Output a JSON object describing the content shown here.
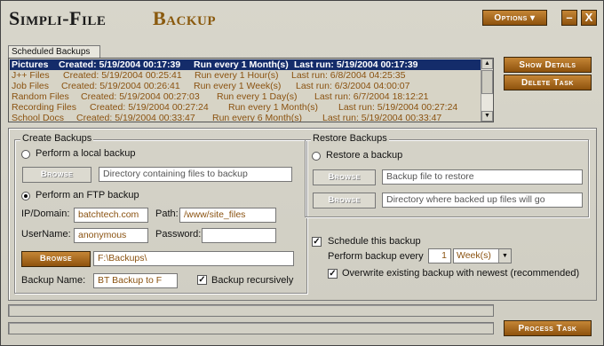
{
  "title": {
    "part1": "Simpli-File",
    "part2": "Backup"
  },
  "window_buttons": {
    "options": "Options ▾",
    "minimize": "–",
    "close": "X"
  },
  "scheduled": {
    "tab_label": "Scheduled Backups",
    "rows": [
      {
        "name": "Pictures",
        "created": "Created: 5/19/2004 00:17:39",
        "every": "Run every 1 Month(s)",
        "last": "Last run: 5/19/2004 00:17:39",
        "selected": true
      },
      {
        "name": "J++ Files",
        "created": "Created: 5/19/2004 00:25:41",
        "every": "Run every 1 Hour(s)",
        "last": "Last run: 6/8/2004 04:25:35"
      },
      {
        "name": "Job Files",
        "created": "Created: 5/19/2004 00:26:41",
        "every": "Run every 1 Week(s)",
        "last": "Last run: 6/3/2004 04:00:07"
      },
      {
        "name": "Random Files",
        "created": "Created: 5/19/2004 00:27:03",
        "every": "Run every 1 Day(s)",
        "last": "Last run: 6/7/2004 18:12:21"
      },
      {
        "name": "Recording Files",
        "created": "Created: 5/19/2004 00:27:24",
        "every": "Run every 1 Month(s)",
        "last": "Last run: 5/19/2004 00:27:24"
      },
      {
        "name": "School Docs",
        "created": "Created: 5/19/2004 00:33:47",
        "every": "Run every 6 Month(s)",
        "last": "Last run: 5/19/2004 00:33:47"
      }
    ],
    "show_details": "Show Details",
    "delete_task": "Delete Task"
  },
  "create": {
    "group_label": "Create Backups",
    "local_radio": "Perform a local backup",
    "browse": "Browse",
    "local_placeholder": "Directory containing files to backup",
    "ftp_radio": "Perform an FTP backup",
    "ip_label": "IP/Domain:",
    "ip_value": "batchtech.com",
    "path_label": "Path:",
    "path_value": "/www/site_files",
    "user_label": "UserName:",
    "user_value": "anonymous",
    "pass_label": "Password:",
    "pass_value": "",
    "dest_browse": "Browse",
    "dest_value": "F:\\Backups\\",
    "name_label": "Backup Name:",
    "name_value": "BT Backup to F",
    "recursive_label": "Backup recursively"
  },
  "restore": {
    "group_label": "Restore Backups",
    "radio": "Restore a backup",
    "browse1": "Browse",
    "file_placeholder": "Backup file to restore",
    "browse2": "Browse",
    "dir_placeholder": "Directory where backed up files will go"
  },
  "schedule": {
    "checkbox": "Schedule this backup",
    "every_label": "Perform backup every",
    "every_value": "1",
    "unit": "Week(s)",
    "overwrite": "Overwrite existing backup with newest (recommended)"
  },
  "process": "Process Task",
  "colors": {
    "accent": "#9a5f14",
    "selection": "#142c6a",
    "value_text": "#8a5210"
  }
}
